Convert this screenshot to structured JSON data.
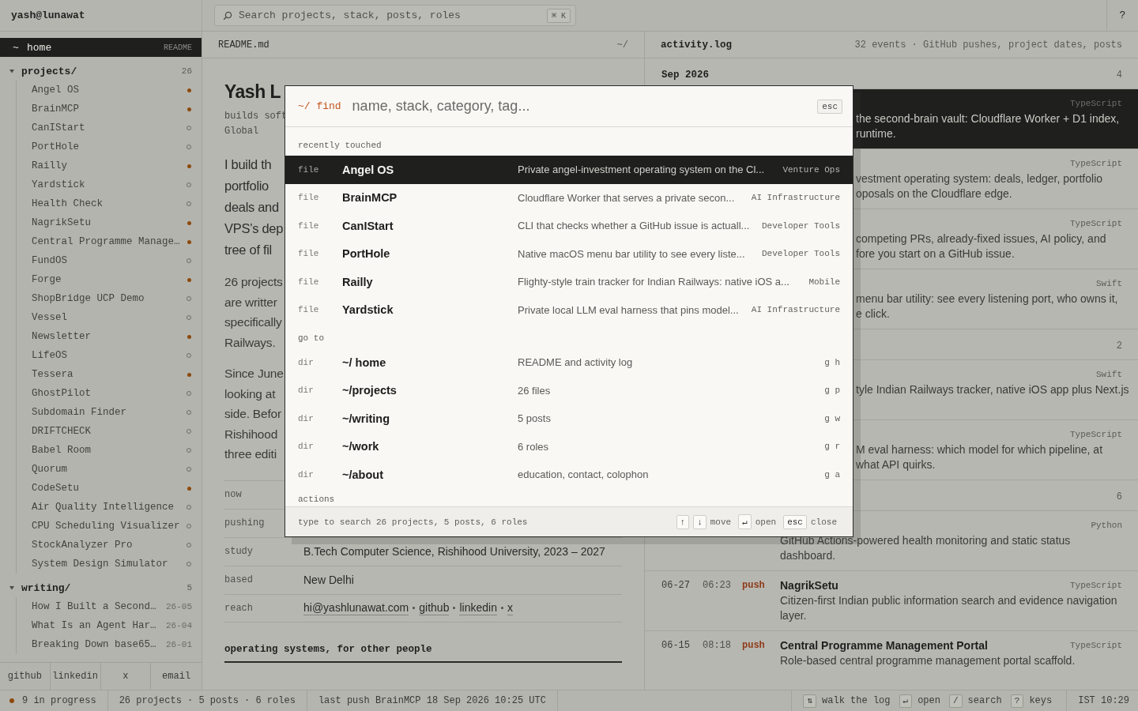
{
  "topbar": {
    "user": "yash@lunawat",
    "search": {
      "placeholder": "Search projects, stack, posts, roles",
      "shortcut": "⌘ K"
    },
    "help": "?"
  },
  "sidebar": {
    "home": {
      "icon": "~",
      "label": "home",
      "hint": "README",
      "selected": true
    },
    "folders": [
      {
        "name": "projects/",
        "count": "26",
        "expanded": true,
        "items": [
          {
            "label": "Angel OS",
            "kind": "project",
            "active": true
          },
          {
            "label": "BrainMCP",
            "kind": "project",
            "active": true
          },
          {
            "label": "CanIStart",
            "kind": "project",
            "active": false
          },
          {
            "label": "PortHole",
            "kind": "project",
            "active": false
          },
          {
            "label": "Railly",
            "kind": "project",
            "active": true
          },
          {
            "label": "Yardstick",
            "kind": "project",
            "active": false
          },
          {
            "label": "Health Check",
            "kind": "project",
            "active": false
          },
          {
            "label": "NagrikSetu",
            "kind": "project",
            "active": true
          },
          {
            "label": "Central Programme Manage…",
            "kind": "project",
            "active": true
          },
          {
            "label": "FundOS",
            "kind": "project",
            "active": false
          },
          {
            "label": "Forge",
            "kind": "project",
            "active": true
          },
          {
            "label": "ShopBridge UCP Demo",
            "kind": "project",
            "active": false
          },
          {
            "label": "Vessel",
            "kind": "project",
            "active": false
          },
          {
            "label": "Newsletter",
            "kind": "project",
            "active": true
          },
          {
            "label": "LifeOS",
            "kind": "project",
            "active": false
          },
          {
            "label": "Tessera",
            "kind": "project",
            "active": true
          },
          {
            "label": "GhostPilot",
            "kind": "project",
            "active": false
          },
          {
            "label": "Subdomain Finder",
            "kind": "project",
            "active": false
          },
          {
            "label": "DRIFTCHECK",
            "kind": "project",
            "active": false
          },
          {
            "label": "Babel Room",
            "kind": "project",
            "active": false
          },
          {
            "label": "Quorum",
            "kind": "project",
            "active": false
          },
          {
            "label": "CodeSetu",
            "kind": "project",
            "active": true
          },
          {
            "label": "Air Quality Intelligence",
            "kind": "project",
            "active": false
          },
          {
            "label": "CPU Scheduling Visualizer",
            "kind": "project",
            "active": false
          },
          {
            "label": "StockAnalyzer Pro",
            "kind": "project",
            "active": false
          },
          {
            "label": "System Design Simulator",
            "kind": "project",
            "active": false
          }
        ]
      },
      {
        "name": "writing/",
        "count": "5",
        "expanded": true,
        "items": [
          {
            "label": "How I Built a Second…",
            "kind": "post",
            "date": "26-05"
          },
          {
            "label": "What Is an Agent Har…",
            "kind": "post",
            "date": "26-04"
          },
          {
            "label": "Breaking Down base65…",
            "kind": "post",
            "date": "26-01"
          }
        ]
      }
    ],
    "links": [
      "github",
      "linkedin",
      "x",
      "email"
    ]
  },
  "readme": {
    "tab": "README.md",
    "path": "~/",
    "title": "Yash L",
    "meta": [
      "builds soft",
      "Global"
    ],
    "paragraphs": [
      {
        "kind": "lead",
        "lines": [
          "I build th",
          "portfolio",
          "deals and",
          "VPS’s dep",
          "tree of fil"
        ]
      },
      {
        "kind": "body",
        "lines": [
          "26 projects",
          "are writter",
          "specifically",
          "Railways."
        ]
      },
      {
        "kind": "body",
        "lines": [
          "Since June",
          "looking at",
          "side. Befor",
          "Rishihood",
          "three editi"
        ]
      }
    ],
    "facts": [
      {
        "key": "now"
      },
      {
        "key": "pushing"
      },
      {
        "key": "study",
        "value": "B.Tech Computer Science, Rishihood University, 2023 – 2027"
      },
      {
        "key": "based",
        "value": "New Delhi"
      },
      {
        "key": "reach",
        "links": [
          "hi@yashlunawat.com",
          "github",
          "linkedin",
          "x"
        ]
      }
    ],
    "section_heading": "operating systems, for other people"
  },
  "activity": {
    "title": "activity.log",
    "summary": "32 events · GitHub pushes, project dates, posts",
    "groups": [
      {
        "label": "Sep 2026",
        "count": "4",
        "items": [
          {
            "kind": "clipped",
            "selected": true,
            "tag": "TypeScript",
            "lines": [
              "the second-brain vault: Cloudflare Worker + D1 index,",
              "runtime."
            ]
          },
          {
            "kind": "clipped",
            "selected": false,
            "tag": "TypeScript",
            "lines": [
              "vestment operating system: deals, ledger, portfolio",
              "oposals on the Cloudflare edge."
            ]
          },
          {
            "kind": "clipped",
            "selected": false,
            "tag": "TypeScript",
            "lines": [
              "competing PRs, already-fixed issues, AI policy, and",
              "fore you start on a GitHub issue."
            ]
          },
          {
            "kind": "clipped",
            "selected": false,
            "tag": "Swift",
            "lines": [
              "menu bar utility: see every listening port, who owns it,",
              "e click."
            ]
          }
        ]
      },
      {
        "count": "2",
        "items": [
          {
            "kind": "clipped",
            "selected": false,
            "tag": "Swift",
            "lines": [
              "tyle Indian Railways tracker, native iOS app plus Next.js"
            ]
          },
          {
            "kind": "clipped",
            "selected": false,
            "tag": "TypeScript",
            "lines": [
              "M eval harness: which model for which pipeline, at",
              "what API quirks."
            ]
          }
        ]
      },
      {
        "count": "6",
        "items": [
          {
            "kind": "body",
            "selected": false,
            "tag": "Python",
            "lines": [
              "GitHub Actions-powered health monitoring and static status dashboard."
            ]
          },
          {
            "kind": "full",
            "selected": false,
            "date": "06-27",
            "time": "06:23",
            "action": "push",
            "title": "NagrikSetu",
            "tag": "TypeScript",
            "lines": [
              "Citizen-first Indian public information search and evidence navigation layer."
            ]
          },
          {
            "kind": "full",
            "selected": false,
            "date": "06-15",
            "time": "08:18",
            "action": "push",
            "title": "Central Programme Management Portal",
            "tag": "TypeScript",
            "lines": [
              "Role-based central programme management portal scaffold."
            ]
          }
        ]
      }
    ]
  },
  "finder": {
    "prompt": "~/ find",
    "placeholder": "name, stack, category, tag...",
    "close": "esc",
    "sections": [
      {
        "label": "recently touched",
        "items": [
          {
            "type": "file",
            "name": "Angel OS",
            "description": "Private angel-investment operating system on the Cl...",
            "category": "Venture Ops",
            "selected": true
          },
          {
            "type": "file",
            "name": "BrainMCP",
            "description": "Cloudflare Worker that serves a private secon...",
            "category": "AI Infrastructure",
            "selected": false
          },
          {
            "type": "file",
            "name": "CanIStart",
            "description": "CLI that checks whether a GitHub issue is actuall...",
            "category": "Developer Tools",
            "selected": false
          },
          {
            "type": "file",
            "name": "PortHole",
            "description": "Native macOS menu bar utility to see every liste...",
            "category": "Developer Tools",
            "selected": false
          },
          {
            "type": "file",
            "name": "Railly",
            "description": "Flighty-style train tracker for Indian Railways: native iOS a...",
            "category": "Mobile",
            "selected": false
          },
          {
            "type": "file",
            "name": "Yardstick",
            "description": "Private local LLM eval harness that pins model...",
            "category": "AI Infrastructure",
            "selected": false
          }
        ]
      },
      {
        "label": "go to",
        "items": [
          {
            "type": "dir",
            "name": "~/ home",
            "description": "README and activity log",
            "shortcut": "g h",
            "selected": false
          },
          {
            "type": "dir",
            "name": "~/projects",
            "description": "26 files",
            "shortcut": "g p",
            "selected": false
          },
          {
            "type": "dir",
            "name": "~/writing",
            "description": "5 posts",
            "shortcut": "g w",
            "selected": false
          },
          {
            "type": "dir",
            "name": "~/work",
            "description": "6 roles",
            "shortcut": "g r",
            "selected": false
          },
          {
            "type": "dir",
            "name": "~/about",
            "description": "education, contact, colophon",
            "shortcut": "g a",
            "selected": false
          }
        ]
      },
      {
        "label": "actions"
      }
    ],
    "footer": "type to search 26 projects, 5 posts, 6 roles",
    "hints": [
      {
        "keys": [
          "↑",
          "↓"
        ],
        "label": "move"
      },
      {
        "keys": [
          "↵"
        ],
        "label": "open"
      },
      {
        "keys": [
          "esc"
        ],
        "label": "close"
      }
    ]
  },
  "status_bar": {
    "progress": "9 in progress",
    "counts": "26 projects · 5 posts · 6 roles",
    "last_push": "last push BrainMCP 18 Sep 2026 10:25 UTC",
    "hints": [
      {
        "key": "⇅",
        "label": "walk the log"
      },
      {
        "key": "↵",
        "label": "open"
      },
      {
        "key": "/",
        "label": "search"
      },
      {
        "key": "?",
        "label": "keys"
      }
    ],
    "clock": "IST 10:29"
  }
}
